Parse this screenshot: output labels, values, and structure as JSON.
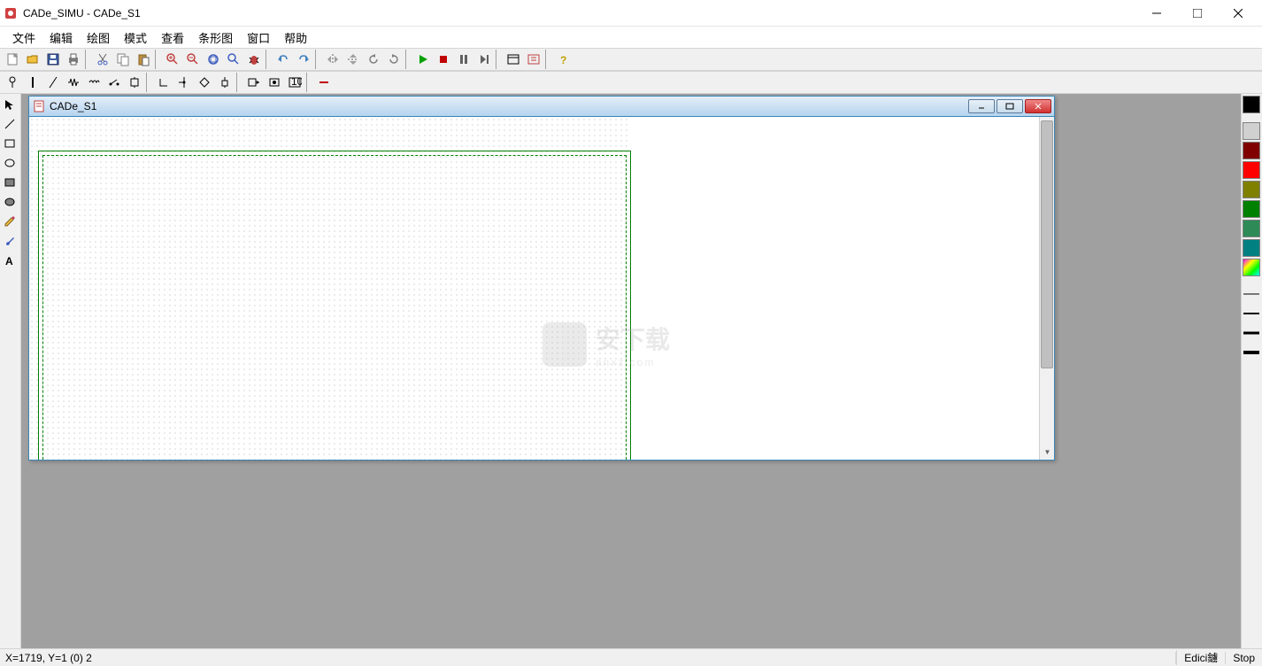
{
  "app": {
    "title": "CADe_SIMU - CADe_S1"
  },
  "menu": {
    "file": "文件",
    "edit": "编辑",
    "draw": "绘图",
    "mode": "模式",
    "view": "查看",
    "bar": "条形图",
    "window": "窗口",
    "help": "帮助"
  },
  "toolbar_icons": {
    "new": "new-file-icon",
    "open": "open-icon",
    "save": "save-icon",
    "print": "print-icon",
    "cut": "cut-icon",
    "copy": "copy-icon",
    "paste": "paste-icon",
    "zoom_in": "zoom-in-icon",
    "zoom_out": "zoom-out-icon",
    "zoom_fit": "zoom-fit-icon",
    "find": "find-icon",
    "bug": "bug-icon",
    "undo": "undo-icon",
    "redo": "redo-icon",
    "mirror_h": "mirror-h-icon",
    "mirror_v": "mirror-v-icon",
    "rotate_l": "rotate-left-icon",
    "rotate_r": "rotate-right-icon",
    "play": "play-icon",
    "stop": "stop-icon",
    "pause": "pause-icon",
    "step": "step-icon",
    "window_tool": "window-tool-icon",
    "sim_config": "sim-config-icon",
    "help": "help-icon"
  },
  "toolbar2_icons": [
    "pin-icon",
    "vertical-line-icon",
    "diagonal-line-icon",
    "resistor-icon",
    "coil-icon",
    "switch-icon",
    "junction-icon",
    "angle-icon",
    "t-junction-icon",
    "diamond-icon",
    "node-icon",
    "box-arrow-icon",
    "box-dot-icon",
    "numbered-box-icon",
    "minus-line-icon"
  ],
  "left_tools": [
    "pointer-icon",
    "line-icon",
    "rectangle-icon",
    "ellipse-icon",
    "filled-rect-icon",
    "filled-ellipse-icon",
    "pencil-icon",
    "brush-icon",
    "text-icon"
  ],
  "child_window": {
    "title": "CADe_S1"
  },
  "colors": {
    "black": "#000000",
    "gray": "#d0d0d0",
    "maroon": "#800000",
    "red": "#ff0000",
    "olive": "#808000",
    "green": "#008000",
    "seagreen": "#2e8b57",
    "teal": "#008080",
    "multi": "rainbow"
  },
  "line_weights": [
    "1",
    "2",
    "3",
    "4"
  ],
  "status": {
    "coords": "X=1719, Y=1 (0) 2",
    "mode": "Edici鐪",
    "state": "Stop"
  },
  "watermark": {
    "text": "安下载",
    "sub": "anxz.com"
  }
}
